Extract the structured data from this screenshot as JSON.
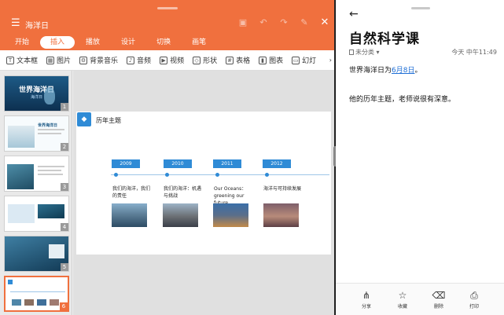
{
  "left": {
    "doc_title": "海洋日",
    "menu_icon": "menu-icon",
    "tabs": [
      {
        "label": "开始",
        "active": false
      },
      {
        "label": "插入",
        "active": true
      },
      {
        "label": "播放",
        "active": false
      },
      {
        "label": "设计",
        "active": false
      },
      {
        "label": "切换",
        "active": false
      },
      {
        "label": "画笔",
        "active": false
      }
    ],
    "ribbon": [
      {
        "label": "文本框",
        "icon": "textbox-icon",
        "glyph": "T"
      },
      {
        "label": "图片",
        "icon": "image-icon",
        "glyph": "▦"
      },
      {
        "label": "背景音乐",
        "icon": "music-settings-icon",
        "glyph": "⚙"
      },
      {
        "label": "音频",
        "icon": "audio-icon",
        "glyph": "♪"
      },
      {
        "label": "视频",
        "icon": "video-icon",
        "glyph": "▶"
      },
      {
        "label": "形状",
        "icon": "shape-icon",
        "glyph": "◇"
      },
      {
        "label": "表格",
        "icon": "table-icon",
        "glyph": "#"
      },
      {
        "label": "图表",
        "icon": "chart-icon",
        "glyph": "▮"
      },
      {
        "label": "幻灯",
        "icon": "slide-icon",
        "glyph": "▭"
      }
    ],
    "slides": [
      {
        "num": "1",
        "title": "世界海洋日",
        "subtitle": "海洋日",
        "selected": false
      },
      {
        "num": "2",
        "title": "世界海洋日",
        "selected": false
      },
      {
        "num": "3",
        "title": "",
        "selected": false
      },
      {
        "num": "4",
        "title": "",
        "selected": false
      },
      {
        "num": "5",
        "title": "",
        "selected": false
      },
      {
        "num": "6",
        "title": "",
        "selected": true
      }
    ],
    "slide": {
      "title": "历年主题",
      "timeline": [
        {
          "year": "2009",
          "desc": "我们的海洋，我们的责任"
        },
        {
          "year": "2010",
          "desc": "我们的海洋：机遇与挑战"
        },
        {
          "year": "2011",
          "desc": "Our Oceans：greening our future"
        },
        {
          "year": "2012",
          "desc": "海洋与可持续发展"
        }
      ]
    }
  },
  "right": {
    "back_icon": "back-arrow-icon",
    "title": "自然科学课",
    "category": "未分类",
    "date": "今天 中午11:49",
    "line1_prefix": "世界海洋日为",
    "line1_link": "6月8日",
    "line1_suffix": "。",
    "line2": "他的历年主题，老师说很有深意。",
    "actions": [
      {
        "label": "分享",
        "icon": "share-icon",
        "glyph": "⋔"
      },
      {
        "label": "收藏",
        "icon": "star-icon",
        "glyph": "☆"
      },
      {
        "label": "删除",
        "icon": "trash-icon",
        "glyph": "🗑"
      },
      {
        "label": "打印",
        "icon": "printer-icon",
        "glyph": "⎙"
      }
    ]
  },
  "colors": {
    "accent": "#f0703e",
    "slide_blue": "#2f8bd6",
    "link": "#1f6fd6"
  }
}
